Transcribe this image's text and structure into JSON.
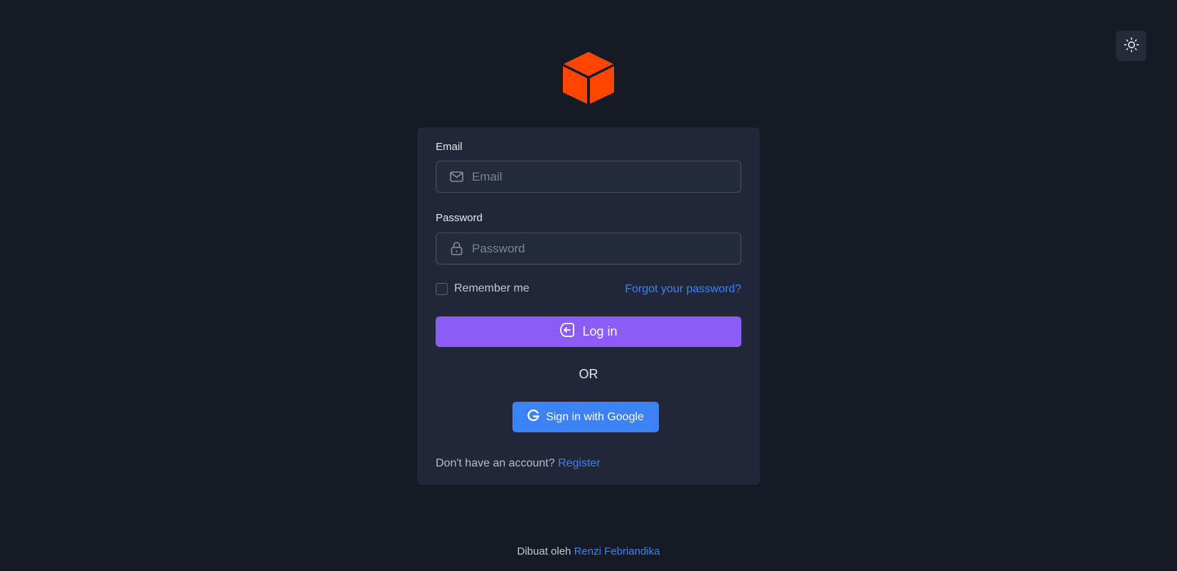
{
  "header": {
    "theme_toggle_icon": "sun-icon",
    "logo_icon": "cube-icon",
    "logo_color": "#ff4500"
  },
  "form": {
    "email_label": "Email",
    "email_placeholder": "Email",
    "email_value": "",
    "password_label": "Password",
    "password_placeholder": "Password",
    "password_value": "",
    "remember_label": "Remember me",
    "remember_checked": false,
    "forgot_label": "Forgot your password?",
    "login_label": "Log in",
    "or_label": "OR",
    "google_label": "Sign in with Google",
    "no_account_text": "Don't have an account?",
    "register_label": "Register"
  },
  "footer": {
    "text": "Dibuat oleh",
    "author": "Renzi Febriandika"
  },
  "colors": {
    "background": "#161a25",
    "card": "#212738",
    "primary": "#8b5cf6",
    "google": "#3b82f6",
    "link": "#3b82f6"
  }
}
